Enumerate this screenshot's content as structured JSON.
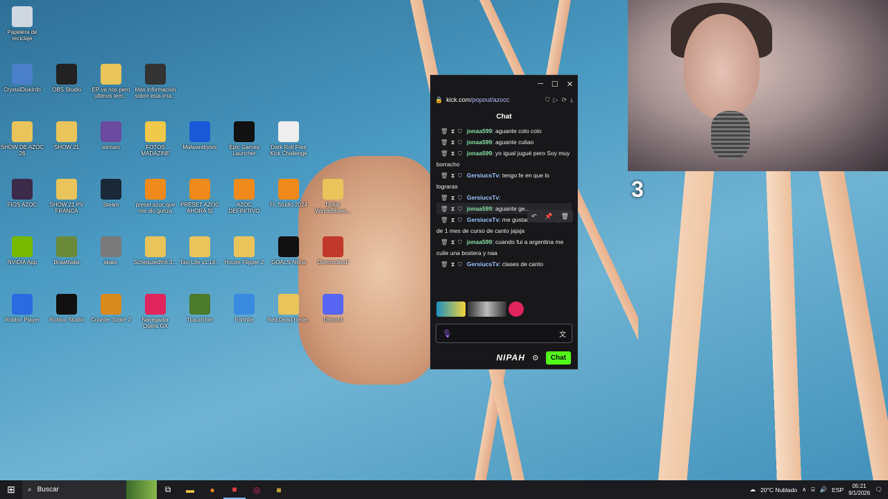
{
  "desktop": {
    "icons": [
      {
        "label": "Papelera de\nreciclaje",
        "icon": "recycle-bin-icon",
        "color": "#cfd8e0"
      },
      {
        "label": "CrystalDiskInfo",
        "icon": "disk-icon",
        "color": "#4a7fc9"
      },
      {
        "label": "OBS Studio",
        "icon": "obs-icon",
        "color": "#222"
      },
      {
        "label": "EP va nos pero\nultimos tem...",
        "icon": "folder-zip-icon",
        "color": "#e9c45a"
      },
      {
        "label": "Mas información\nsobre esta ima...",
        "icon": "camera-icon",
        "color": "#333"
      },
      {
        "label": "SHOW DE AZOC\n26",
        "icon": "folder-zip-icon",
        "color": "#e9c45a"
      },
      {
        "label": "SHOW 21",
        "icon": "folder-zip-icon",
        "color": "#e9c45a"
      },
      {
        "label": "winrars",
        "icon": "winrar-icon",
        "color": "#6b4aa0"
      },
      {
        "label": "FOTOS\nMADAZINE",
        "icon": "folder-icon",
        "color": "#f0c84a"
      },
      {
        "label": "Malwarebytes",
        "icon": "malwarebytes-icon",
        "color": "#1a5ad8"
      },
      {
        "label": "Epic Games\nLauncher",
        "icon": "epic-games-icon",
        "color": "#111"
      },
      {
        "label": "Dark Roll Free\nKick Challenge",
        "icon": "soccer-ball-icon",
        "color": "#eee"
      },
      {
        "label": "FIOS AZOC",
        "icon": "folder-zip-icon",
        "color": "#3b2a4a"
      },
      {
        "label": "SHOW 21 PV\nFRANCA",
        "icon": "folder-zip-icon",
        "color": "#e9c45a"
      },
      {
        "label": "Steam",
        "icon": "steam-icon",
        "color": "#1b2838"
      },
      {
        "label": "preset azoc que\nme dio gonza",
        "icon": "fl-studio-icon",
        "color": "#f08a1c"
      },
      {
        "label": "PRESET AZOC\nAHORA SI",
        "icon": "fl-studio-icon",
        "color": "#f08a1c"
      },
      {
        "label": "AZOC\nDEFINITIVO",
        "icon": "fl-studio-icon",
        "color": "#f08a1c"
      },
      {
        "label": "FL Studio 2024",
        "icon": "fl-studio-icon",
        "color": "#f08a1c"
      },
      {
        "label": "Dollar\nWindeBlowe...",
        "icon": "folder-zip-icon",
        "color": "#e9c45a"
      },
      {
        "label": "NVIDIA App",
        "icon": "nvidia-icon",
        "color": "#76b900"
      },
      {
        "label": "Brawlhalla",
        "icon": "brawlhalla-icon",
        "color": "#6a8a3a"
      },
      {
        "label": "skate.",
        "icon": "skate-icon",
        "color": "#7a7a7a"
      },
      {
        "label": "Scheduled\\h6.3...",
        "icon": "folder-zip-icon",
        "color": "#e9c45a"
      },
      {
        "label": "Taxi Life v1.14...",
        "icon": "folder-zip-icon",
        "color": "#e9c45a"
      },
      {
        "label": "House Flipper 2",
        "icon": "folder-zip-icon",
        "color": "#e9c45a"
      },
      {
        "label": "GOALS Alpha",
        "icon": "goals-icon",
        "color": "#111"
      },
      {
        "label": "Overcooked!",
        "icon": "overcooked-icon",
        "color": "#c0392b"
      },
      {
        "label": "Roblox Player",
        "icon": "roblox-icon",
        "color": "#2a6be0"
      },
      {
        "label": "Roblox Studio",
        "icon": "roblox-studio-icon",
        "color": "#111"
      },
      {
        "label": "Counter Strike 2",
        "icon": "counter-strike-icon",
        "color": "#d88a1c"
      },
      {
        "label": "Navegador\nOpera GX",
        "icon": "opera-gx-icon",
        "color": "#e0245e"
      },
      {
        "label": "TLauncher",
        "icon": "minecraft-icon",
        "color": "#4a7a2a"
      },
      {
        "label": "Fortnite",
        "icon": "fortnite-icon",
        "color": "#3a8ae0"
      },
      {
        "label": "Red.Dead.Rede...",
        "icon": "folder-zip-icon",
        "color": "#e9c45a"
      },
      {
        "label": "Discord",
        "icon": "discord-icon",
        "color": "#5865f2"
      }
    ]
  },
  "webcam": {
    "overlay_number": "3"
  },
  "chat_window": {
    "url_domain": "kick.com",
    "url_path": "/popout/azocc",
    "title": "Chat",
    "messages": [
      {
        "user": "jonaa599",
        "user_color": "#8ae0a6",
        "text": ": aguante colo colo"
      },
      {
        "user": "jonaa599",
        "user_color": "#8ae0a6",
        "text": ": aguante culiao"
      },
      {
        "user": "jonaa599",
        "user_color": "#8ae0a6",
        "text": ": yo igual jugué pero Soy muy borracho"
      },
      {
        "user": "GersiucsTv",
        "user_color": "#9ec6ff",
        "text": ": tengo fe en que lo lograras"
      },
      {
        "user": "GersiucsTv",
        "user_color": "#9ec6ff",
        "text": ":"
      },
      {
        "user": "jonaa599",
        "user_color": "#8ae0a6",
        "text": ": aguante ge..."
      },
      {
        "user": "GersiucsTv",
        "user_color": "#9ec6ff",
        "text": ": me gustaria oirte despues de 1 mes de curso de canto jajaja"
      },
      {
        "user": "jonaa599",
        "user_color": "#8ae0a6",
        "text": ": cuando fui a argentina me culie una bostera y naa"
      },
      {
        "user": "GersiucsTv",
        "user_color": "#9ec6ff",
        "text": ": clases de canto"
      }
    ],
    "input_placeholder": "",
    "brand": "NIPAH",
    "send_label": "Chat"
  },
  "taskbar": {
    "search_placeholder": "Buscar",
    "weather": "20°C  Nublado",
    "language": "ESP",
    "time": "05:21",
    "date": "9/1/2026"
  }
}
